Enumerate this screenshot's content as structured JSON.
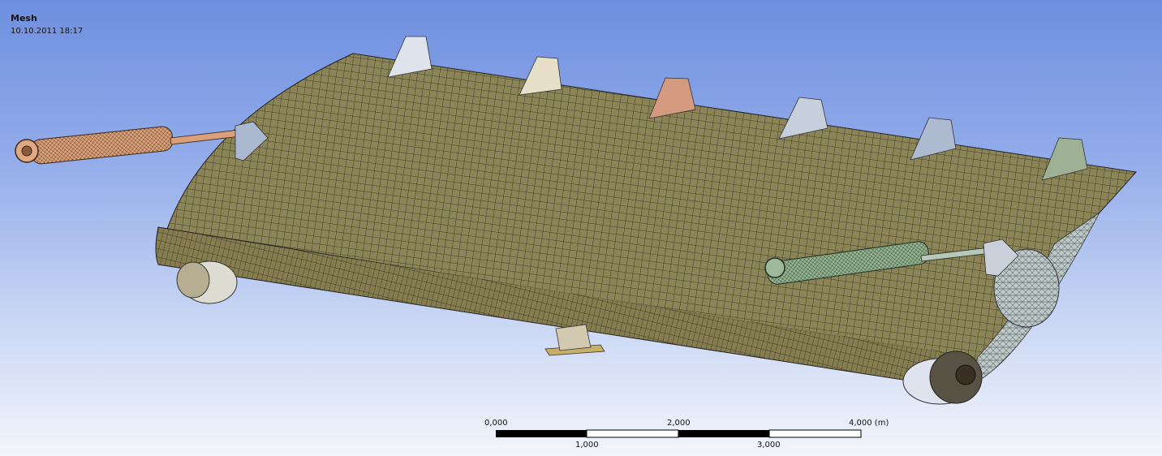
{
  "viewport": {
    "title": "Mesh",
    "date": "10.10.2011 18:17",
    "background_top": "#6e8fdf",
    "background_bottom": "#f3f5fb"
  },
  "model": {
    "panel_color": "#8b8456",
    "mesh_line_color": "#2d2b1f",
    "left_cylinder_color": "#e0a882",
    "right_cylinder_color": "#9db89a",
    "bracket_colors": [
      "#dfe3ec",
      "#e7dfc7",
      "#d49a80",
      "#c7cedc",
      "#aebad0",
      "#9fb194"
    ]
  },
  "scale_bar": {
    "top_labels": [
      "0,000",
      "2,000",
      "4,000 (m)"
    ],
    "bottom_labels": [
      "1,000",
      "3,000"
    ]
  }
}
